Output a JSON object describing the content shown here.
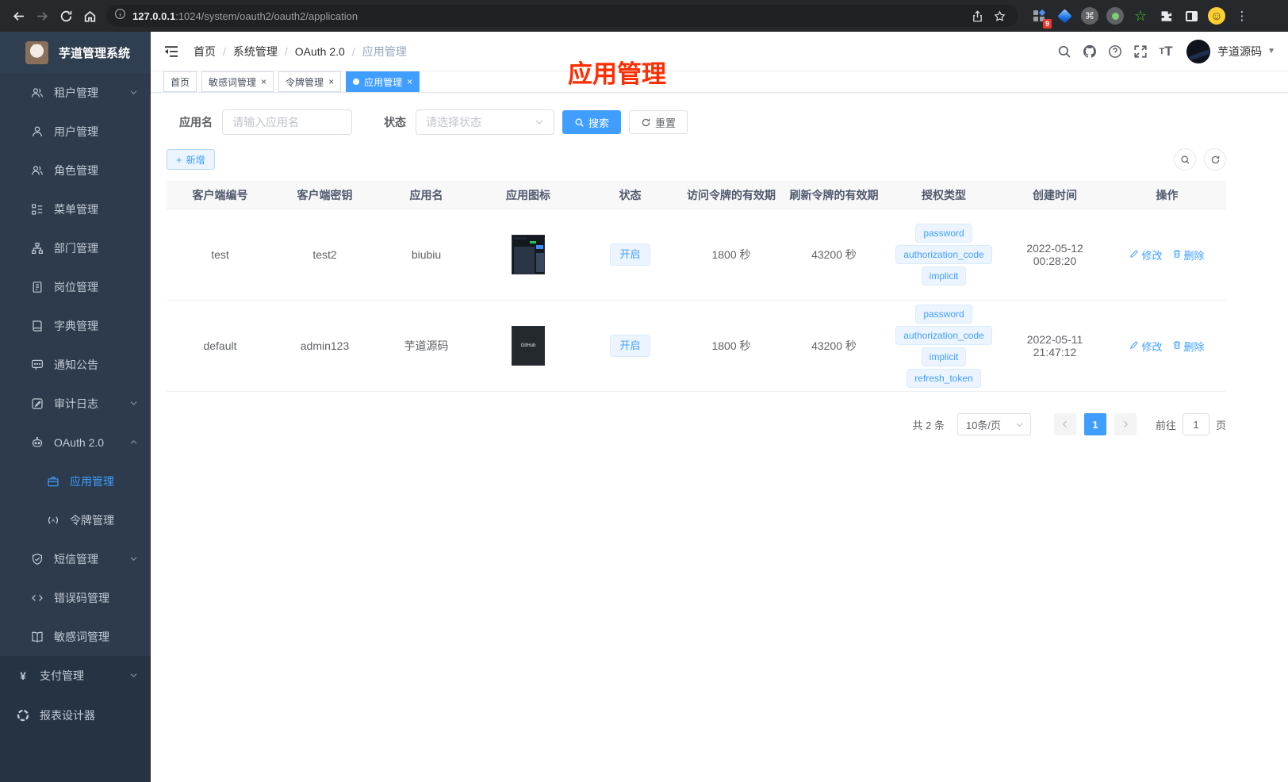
{
  "browser": {
    "url_host": "127.0.0.1",
    "url_rest": ":1024/system/oauth2/oauth2/application",
    "extension_badge": "9"
  },
  "sidebar": {
    "app_title": "芋道管理系统",
    "items": [
      {
        "key": "tenant",
        "label": "租户管理",
        "icon": "users-icon",
        "level": 1,
        "arrow": "down",
        "group": "sub"
      },
      {
        "key": "user",
        "label": "用户管理",
        "icon": "user-icon",
        "level": 1,
        "group": "sub"
      },
      {
        "key": "role",
        "label": "角色管理",
        "icon": "users-icon",
        "level": 1,
        "group": "sub"
      },
      {
        "key": "menu",
        "label": "菜单管理",
        "icon": "tree-icon",
        "level": 1,
        "group": "sub"
      },
      {
        "key": "dept",
        "label": "部门管理",
        "icon": "org-icon",
        "level": 1,
        "group": "sub"
      },
      {
        "key": "post",
        "label": "岗位管理",
        "icon": "badge-icon",
        "level": 1,
        "group": "sub"
      },
      {
        "key": "dict",
        "label": "字典管理",
        "icon": "dict-icon",
        "level": 1,
        "group": "sub"
      },
      {
        "key": "notice",
        "label": "通知公告",
        "icon": "message-icon",
        "level": 1,
        "group": "sub"
      },
      {
        "key": "audit-log",
        "label": "审计日志",
        "icon": "log-icon",
        "level": 1,
        "arrow": "down",
        "group": "sub"
      },
      {
        "key": "oauth2",
        "label": "OAuth 2.0",
        "icon": "robot-icon",
        "level": 1,
        "arrow": "up",
        "group": "sub"
      },
      {
        "key": "oauth2-application",
        "label": "应用管理",
        "icon": "briefcase-icon",
        "level": 2,
        "active": true,
        "group": "sub"
      },
      {
        "key": "oauth2-token",
        "label": "令牌管理",
        "icon": "token-icon",
        "level": 2,
        "group": "sub"
      },
      {
        "key": "sms",
        "label": "短信管理",
        "icon": "shield-icon",
        "level": 1,
        "arrow": "down",
        "group": "sub"
      },
      {
        "key": "error-code",
        "label": "错误码管理",
        "icon": "code-icon",
        "level": 1,
        "group": "sub"
      },
      {
        "key": "sensitive-word",
        "label": "敏感词管理",
        "icon": "book-icon",
        "level": 1,
        "group": "sub"
      },
      {
        "key": "pay",
        "label": "支付管理",
        "icon": "yen-icon",
        "level": 0,
        "arrow": "down",
        "group": "top"
      },
      {
        "key": "report-designer",
        "label": "报表设计器",
        "icon": "report-icon",
        "level": 0,
        "group": "top"
      }
    ]
  },
  "navbar": {
    "breadcrumb": [
      "首页",
      "系统管理",
      "OAuth 2.0",
      "应用管理"
    ],
    "username": "芋道源码"
  },
  "tags_view": [
    {
      "label": "首页",
      "closable": false,
      "active": false
    },
    {
      "label": "敏感词管理",
      "closable": true,
      "active": false
    },
    {
      "label": "令牌管理",
      "closable": true,
      "active": false
    },
    {
      "label": "应用管理",
      "closable": true,
      "active": true
    }
  ],
  "annotation": {
    "text": "应用管理",
    "color": "#ff2d00"
  },
  "filters": {
    "name_label": "应用名",
    "name_placeholder": "请输入应用名",
    "status_label": "状态",
    "status_placeholder": "请选择状态",
    "search_label": "搜索",
    "reset_label": "重置",
    "add_label": "新增"
  },
  "table": {
    "columns": [
      "客户端编号",
      "客户端密钥",
      "应用名",
      "应用图标",
      "状态",
      "访问令牌的有效期",
      "刷新令牌的有效期",
      "授权类型",
      "创建时间",
      "操作"
    ],
    "rows": [
      {
        "client_id": "test",
        "secret": "test2",
        "name": "biubiu",
        "icon": "dashboard-thumbnail",
        "icon_text": "",
        "status": "开启",
        "access_ttl": "1800 秒",
        "refresh_ttl": "43200 秒",
        "grant_types": [
          "password",
          "authorization_code",
          "implicit"
        ],
        "created": "2022-05-12 00:28:20"
      },
      {
        "client_id": "default",
        "secret": "admin123",
        "name": "芋道源码",
        "icon": "github-thumbnail",
        "icon_text": "GitHub",
        "status": "开启",
        "access_ttl": "1800 秒",
        "refresh_ttl": "43200 秒",
        "grant_types": [
          "password",
          "authorization_code",
          "implicit",
          "refresh_token"
        ],
        "created": "2022-05-11 21:47:12"
      }
    ],
    "edit_label": "修改",
    "delete_label": "删除"
  },
  "pagination": {
    "total": "共 2 条",
    "page_size": "10条/页",
    "current_page": "1",
    "goto_label": "前往",
    "goto_value": "1",
    "page_label": "页"
  },
  "colors": {
    "accent": "#409eff",
    "sidebar_bg": "#253342",
    "tag_bg": "#ecf5ff"
  }
}
